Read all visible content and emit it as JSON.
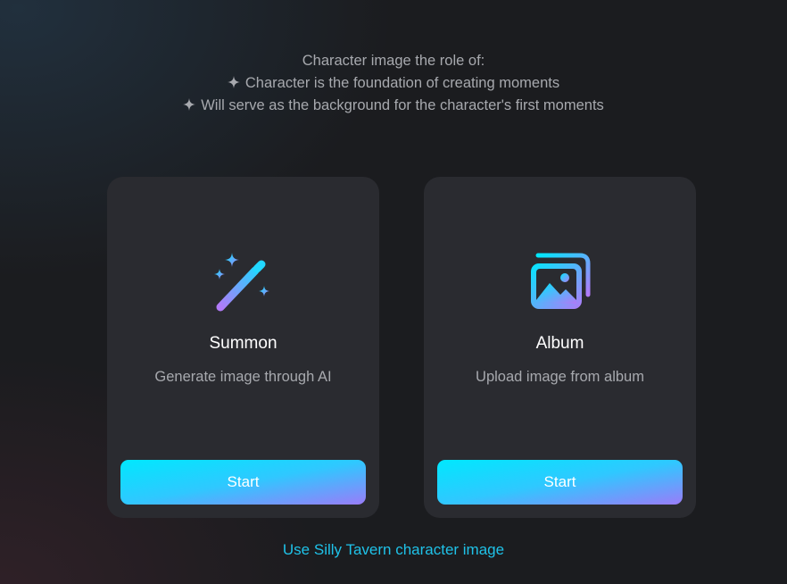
{
  "intro": {
    "heading": "Character image the role of:",
    "points": [
      "Character is the foundation of creating moments",
      "Will serve as the background for the character's first moments"
    ],
    "bullet_icon": "sparkle-icon"
  },
  "cards": [
    {
      "icon": "magic-wand-icon",
      "title": "Summon",
      "description": "Generate image through AI",
      "button_label": "Start"
    },
    {
      "icon": "album-icon",
      "title": "Album",
      "description": "Upload image from album",
      "button_label": "Start"
    }
  ],
  "footer": {
    "link_label": "Use Silly Tavern character image"
  },
  "colors": {
    "background": "#1b1c1f",
    "card": "#2a2b30",
    "muted_text": "#a7a9ae",
    "button_gradient_start": "#00e8fe",
    "button_gradient_end": "#9a7cf9",
    "icon_gradient_start": "#00e8fe",
    "icon_gradient_end": "#b17af8",
    "link": "#1fc2e8"
  }
}
